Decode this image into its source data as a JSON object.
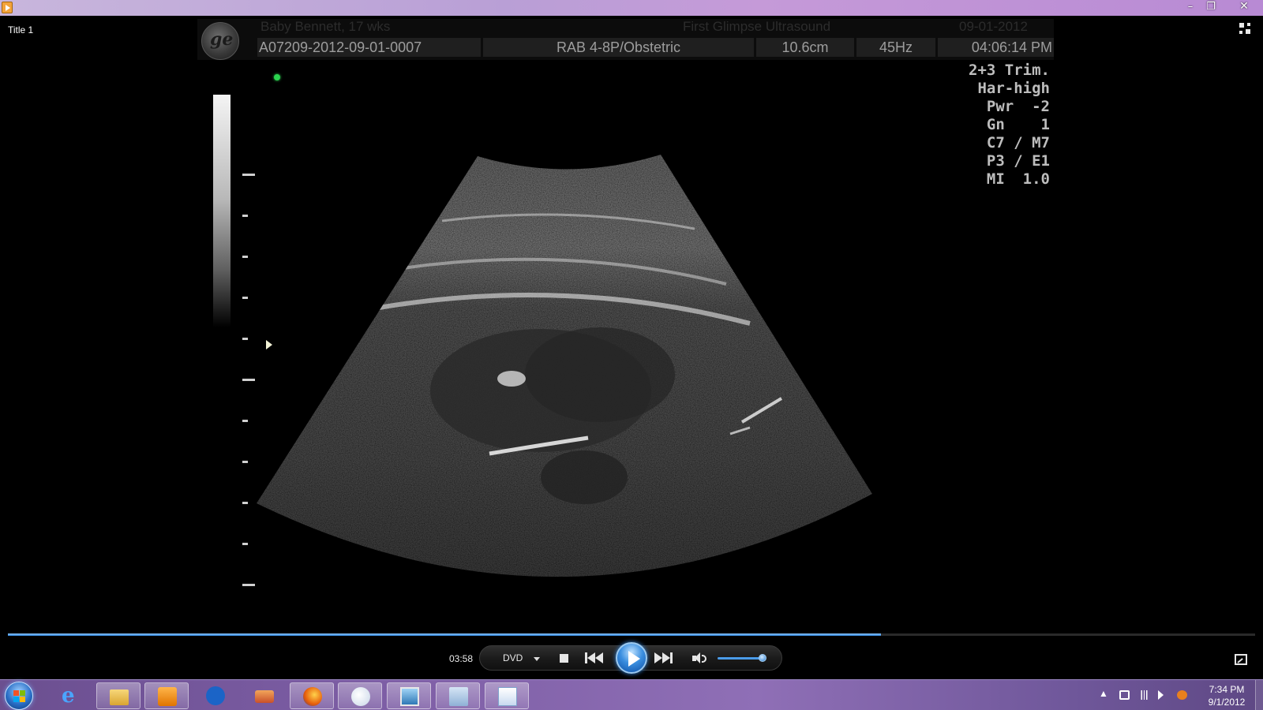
{
  "window": {
    "title": "",
    "controls": {
      "minimize": "–",
      "restore": "❐",
      "close": "✕"
    }
  },
  "video": {
    "title_label": "Title 1",
    "ultrasound": {
      "header_row1": [
        "Baby Bennett, 17 wks",
        "First Glimpse Ultrasound",
        "09-01-2012"
      ],
      "header_row2": [
        "A07209-2012-09-01-0007",
        "RAB 4-8P/Obstetric",
        "10.6cm",
        "45Hz",
        "04:06:14 PM"
      ],
      "params": [
        "2+3 Trim.",
        "Har-high",
        "Pwr  -2",
        "Gn    1",
        "C7 / M7",
        "P3 / E1",
        "MI  1.0"
      ],
      "logo_icon": "ge-logo-icon"
    }
  },
  "player": {
    "elapsed": "03:58",
    "progress_fraction": 0.7,
    "source_label": "DVD",
    "volume_fraction": 0.95,
    "icons": [
      "stop-icon",
      "previous-icon",
      "play-icon",
      "next-icon",
      "volume-icon",
      "switch-to-library-icon",
      "fullscreen-icon"
    ]
  },
  "taskbar": {
    "apps": [
      "start-orb",
      "internet-explorer",
      "windows-explorer",
      "windows-media-player",
      "hp-app",
      "photo-app",
      "firefox",
      "paint",
      "photo-viewer",
      "calculator",
      "wordpad"
    ],
    "tray": {
      "show_hidden": "▲"
    },
    "clock": {
      "time": "7:34 PM",
      "date": "9/1/2012"
    }
  },
  "colors": {
    "accent": "#3b8fe0",
    "taskbar": "#7d5ea5",
    "titlebar": "#c59ad8"
  }
}
